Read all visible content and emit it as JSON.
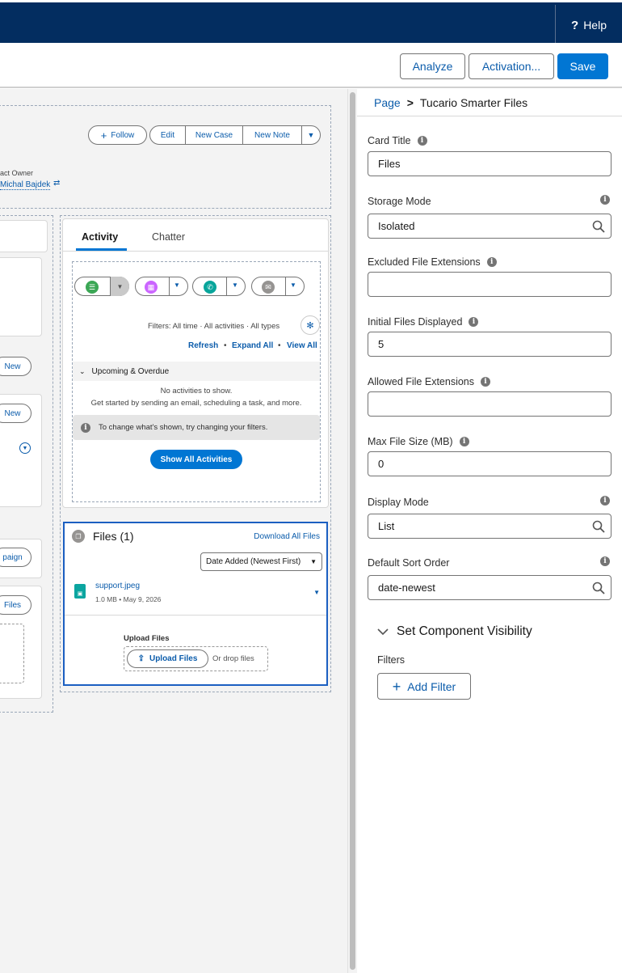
{
  "topbar": {
    "help_label": "Help"
  },
  "toolbar": {
    "analyze_label": "Analyze",
    "activation_label": "Activation...",
    "save_label": "Save"
  },
  "record_header": {
    "follow_label": "Follow",
    "edit_label": "Edit",
    "new_case_label": "New Case",
    "new_note_label": "New Note",
    "owner_label": "act Owner",
    "owner_name": "Michal Bajdek"
  },
  "left_column": {
    "new_label_1": "New",
    "new_label_2": "New",
    "campaign_label": "paign",
    "files_label": "Files"
  },
  "activity": {
    "tab_activity": "Activity",
    "tab_chatter": "Chatter",
    "filters_text": "Filters: All time · All activities · All types",
    "refresh": "Refresh",
    "expand_all": "Expand All",
    "view_all": "View All",
    "upcoming": "Upcoming & Overdue",
    "no_activities": "No activities to show.",
    "get_started": "Get started by sending an email, scheduling a task, and more.",
    "change_filters": "To change what's shown, try changing your filters.",
    "show_all": "Show All Activities"
  },
  "files_card": {
    "title": "Files (1)",
    "download_all": "Download All Files",
    "sort_value": "Date Added (Newest First)",
    "file_name": "support.jpeg",
    "file_meta": "1.0 MB • May 9, 2026",
    "upload_heading": "Upload Files",
    "upload_button": "Upload Files",
    "drop_text": "Or drop files"
  },
  "panel": {
    "breadcrumb_root": "Page",
    "breadcrumb_sep": ">",
    "breadcrumb_current": "Tucario Smarter Files",
    "fields": {
      "card_title": {
        "label": "Card Title",
        "value": "Files"
      },
      "storage_mode": {
        "label": "Storage Mode",
        "value": "Isolated"
      },
      "excluded_ext": {
        "label": "Excluded File Extensions",
        "value": ""
      },
      "initial_files": {
        "label": "Initial Files Displayed",
        "value": "5"
      },
      "allowed_ext": {
        "label": "Allowed File Extensions",
        "value": ""
      },
      "max_size": {
        "label": "Max File Size (MB)",
        "value": "0"
      },
      "display_mode": {
        "label": "Display Mode",
        "value": "List"
      },
      "sort_order": {
        "label": "Default Sort Order",
        "value": "date-newest"
      }
    },
    "visibility_title": "Set Component Visibility",
    "filters_label": "Filters",
    "add_filter": "Add Filter"
  },
  "colors": {
    "nav": "#032d60",
    "brand": "#0176d3",
    "link": "#0b5cab"
  }
}
